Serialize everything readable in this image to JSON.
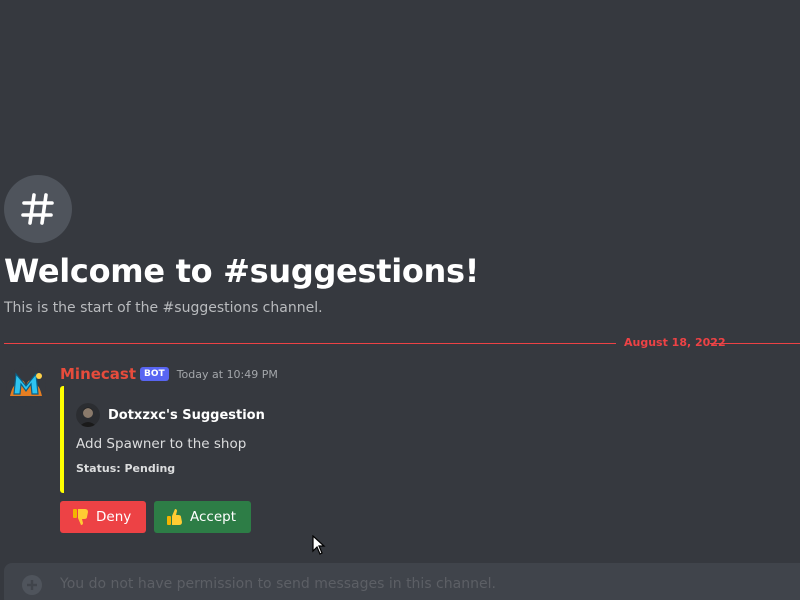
{
  "channel": {
    "icon": "hashtag-icon",
    "welcome_title": "Welcome to #suggestions!",
    "welcome_subtitle": "This is the start of the #suggestions channel."
  },
  "divider": {
    "date": "August 18, 2022",
    "color": "#ed4245"
  },
  "message": {
    "author": "Minecast",
    "author_color": "#e74c3c",
    "bot_tag": "BOT",
    "timestamp": "Today at 10:49 PM",
    "avatar_icon": "minecast-logo-icon",
    "embed": {
      "accent_color": "#ffff00",
      "author_name": "Dotxzxc's Suggestion",
      "author_avatar_icon": "user-avatar-icon",
      "description": "Add Spawner to the shop",
      "status": "Status: Pending"
    },
    "buttons": [
      {
        "label": "Deny",
        "icon": "thumbs-down-icon",
        "color": "#ed4245"
      },
      {
        "label": "Accept",
        "icon": "thumbs-up-icon",
        "color": "#2d7d46"
      }
    ]
  },
  "composer": {
    "icon": "plus-circle-icon",
    "placeholder": "You do not have permission to send messages in this channel."
  }
}
